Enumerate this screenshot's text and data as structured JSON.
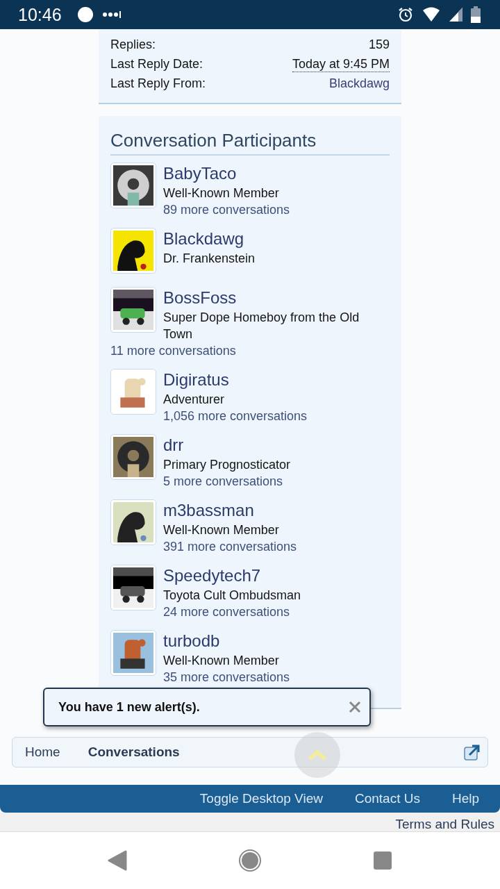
{
  "status_bar": {
    "time": "10:46"
  },
  "thread_info": {
    "rows": [
      {
        "label": "Replies:",
        "value": "159",
        "kind": "plain"
      },
      {
        "label": "Last Reply Date:",
        "value": "Today at 9:45 PM",
        "kind": "date"
      },
      {
        "label": "Last Reply From:",
        "value": "Blackdawg",
        "kind": "link"
      }
    ]
  },
  "participants": {
    "title": "Conversation Participants",
    "members": [
      {
        "name": "BabyTaco",
        "title": "Well-Known Member",
        "conversations": "89 more conversations"
      },
      {
        "name": "Blackdawg",
        "title": "Dr. Frankenstein"
      },
      {
        "name": "BossFoss",
        "title": "Super Dope Homeboy from the Old Town",
        "conversations": "11 more conversations"
      },
      {
        "name": "Digiratus",
        "title": "Adventurer",
        "conversations": "1,056 more conversations"
      },
      {
        "name": "drr",
        "title": "Primary Prognosticator",
        "conversations": "5 more conversations"
      },
      {
        "name": "m3bassman",
        "title": "Well-Known Member",
        "conversations": "391 more conversations"
      },
      {
        "name": "Speedytech7",
        "title": "Toyota Cult Ombudsman",
        "conversations": "24 more conversations"
      },
      {
        "name": "turbodb",
        "title": "Well-Known Member",
        "conversations": "35 more conversations"
      }
    ]
  },
  "alert": {
    "message": "You have 1 new alert(s)."
  },
  "breadcrumbs": [
    {
      "label": "Home",
      "current": false
    },
    {
      "label": "Conversations",
      "current": true
    }
  ],
  "footer": {
    "links": [
      "Toggle Desktop View",
      "Contact Us",
      "Help"
    ],
    "terms": "Terms and Rules"
  }
}
